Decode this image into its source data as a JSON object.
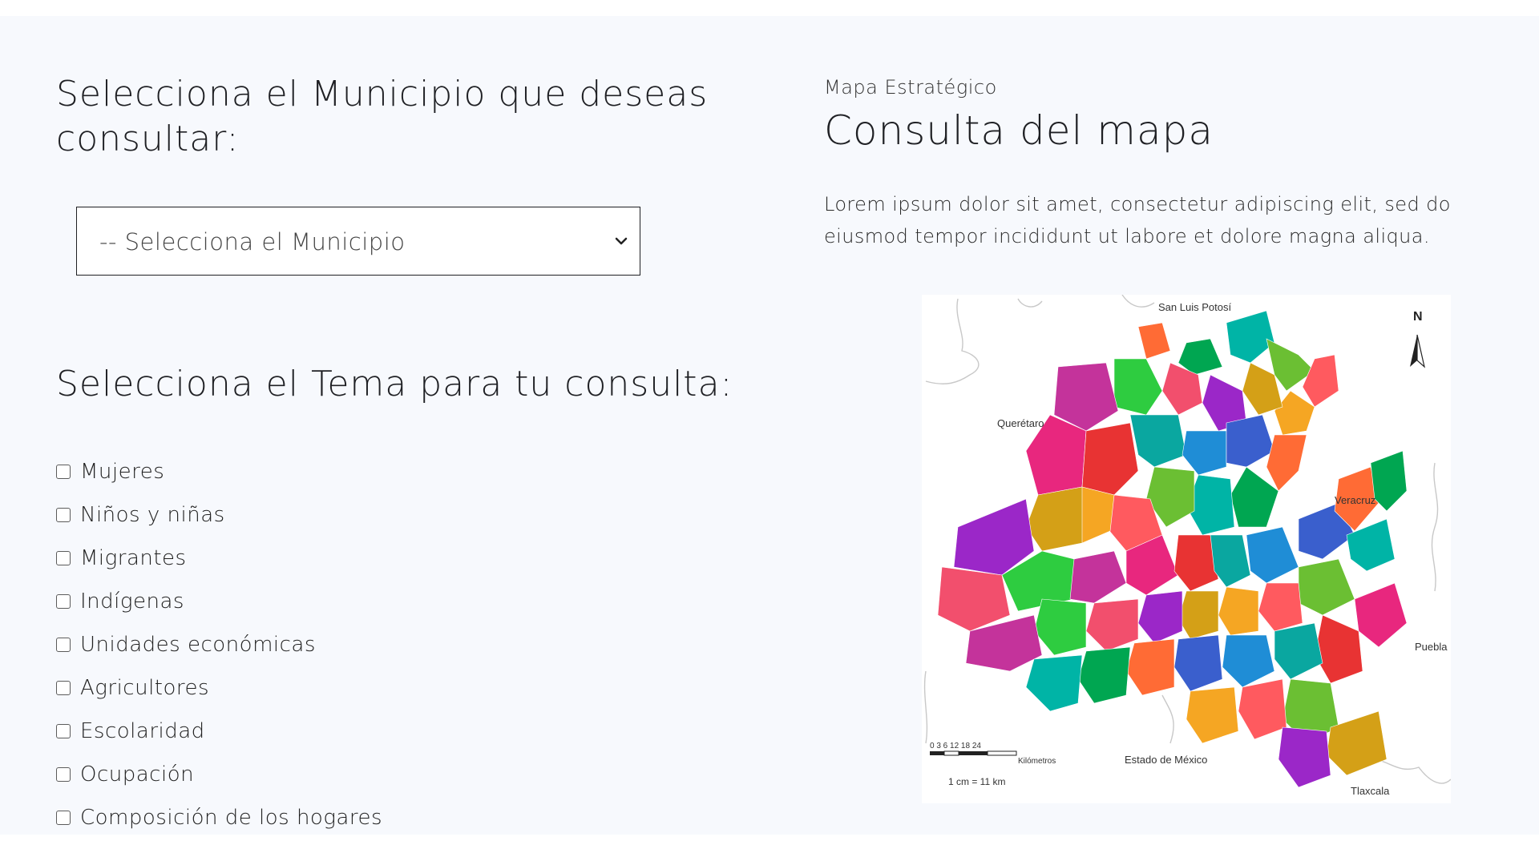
{
  "left": {
    "municipio_heading": "Selecciona el Municipio que deseas consultar:",
    "municipio_select_value": "-- Selecciona el Municipio",
    "tema_heading": "Selecciona el Tema para tu consulta:",
    "topics": [
      "Mujeres",
      "Niños y niñas",
      "Migrantes",
      "Indígenas",
      "Unidades económicas",
      "Agricultores",
      "Escolaridad",
      "Ocupación",
      "Composición de los hogares"
    ]
  },
  "right": {
    "eyebrow": "Mapa Estratégico",
    "title": "Consulta del mapa",
    "body": "Lorem ipsum dolor sit amet, consectetur adipiscing elit, sed do eiusmod tempor incididunt ut labore et dolore magna aliqua."
  },
  "map": {
    "labels": {
      "north": "N",
      "san_luis": "San Luis Potosí",
      "queretaro": "Querétaro",
      "veracruz": "Veracruz",
      "puebla": "Puebla",
      "edomex": "Estado de México",
      "tlaxcala": "Tlaxcala",
      "scale_ticks": "0 3 6    12    18    24",
      "scale_unit": "Kilómetros",
      "scale_ratio": "1 cm = 11 km"
    },
    "palette": [
      "#e8277e",
      "#00b4a6",
      "#2ecc40",
      "#ff6b35",
      "#9b27c8",
      "#1f8dd6",
      "#f5a623",
      "#e83333",
      "#6bbf33",
      "#c4339b",
      "#00a651",
      "#f24f6d",
      "#3a5fcd",
      "#d4a017",
      "#0aa7a0",
      "#ff5a5f"
    ]
  }
}
